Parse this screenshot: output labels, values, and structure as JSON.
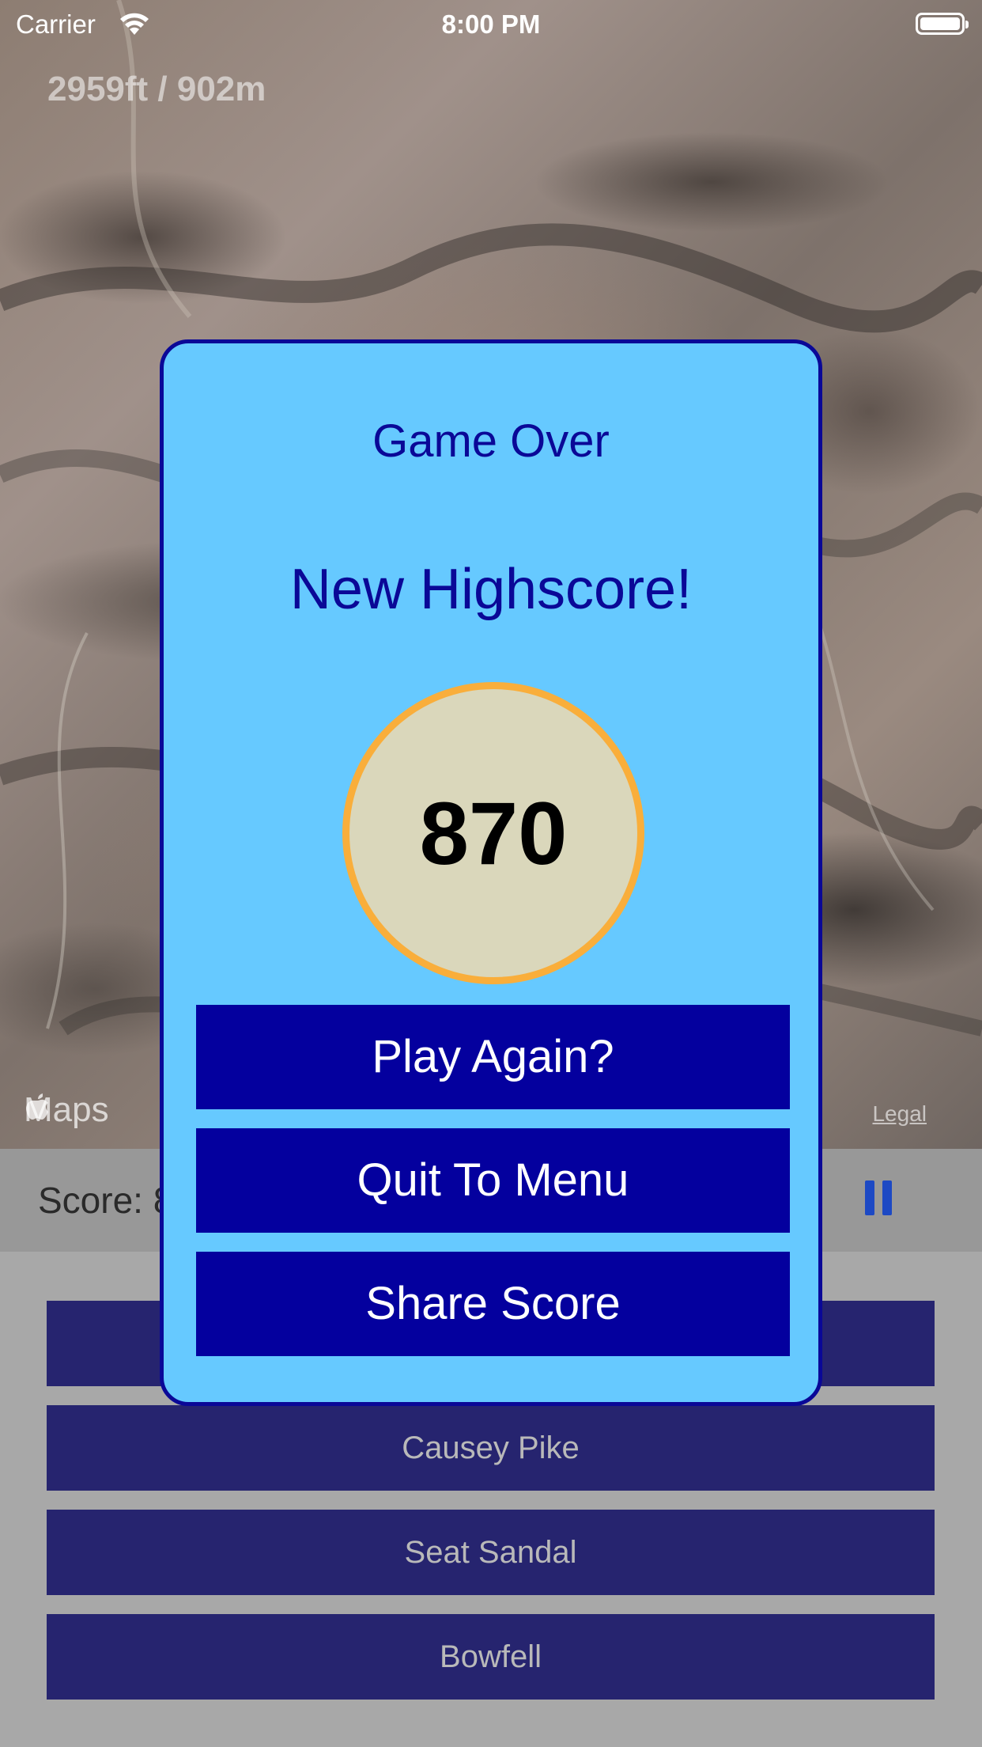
{
  "status_bar": {
    "carrier": "Carrier",
    "time": "8:00 PM"
  },
  "map": {
    "altitude": "2959ft / 902m",
    "maps_logo": "Maps",
    "legal": "Legal"
  },
  "game": {
    "score_label": "Score: 8",
    "answers": [
      "",
      "Causey Pike",
      "Seat Sandal",
      "Bowfell"
    ]
  },
  "modal": {
    "title": "Game Over",
    "subtitle": "New Highscore!",
    "score": "870",
    "play_again": "Play Again?",
    "quit": "Quit To Menu",
    "share": "Share Score"
  },
  "colors": {
    "modal_bg": "#66c9ff",
    "modal_border": "#0a0897",
    "button_bg": "#04009e",
    "circle_fill": "#dad7bb",
    "circle_ring": "#f9ae3b",
    "answer_bg": "#26246f"
  },
  "icons": [
    "wifi-icon",
    "battery-icon",
    "apple-logo-icon",
    "pause-icon"
  ]
}
